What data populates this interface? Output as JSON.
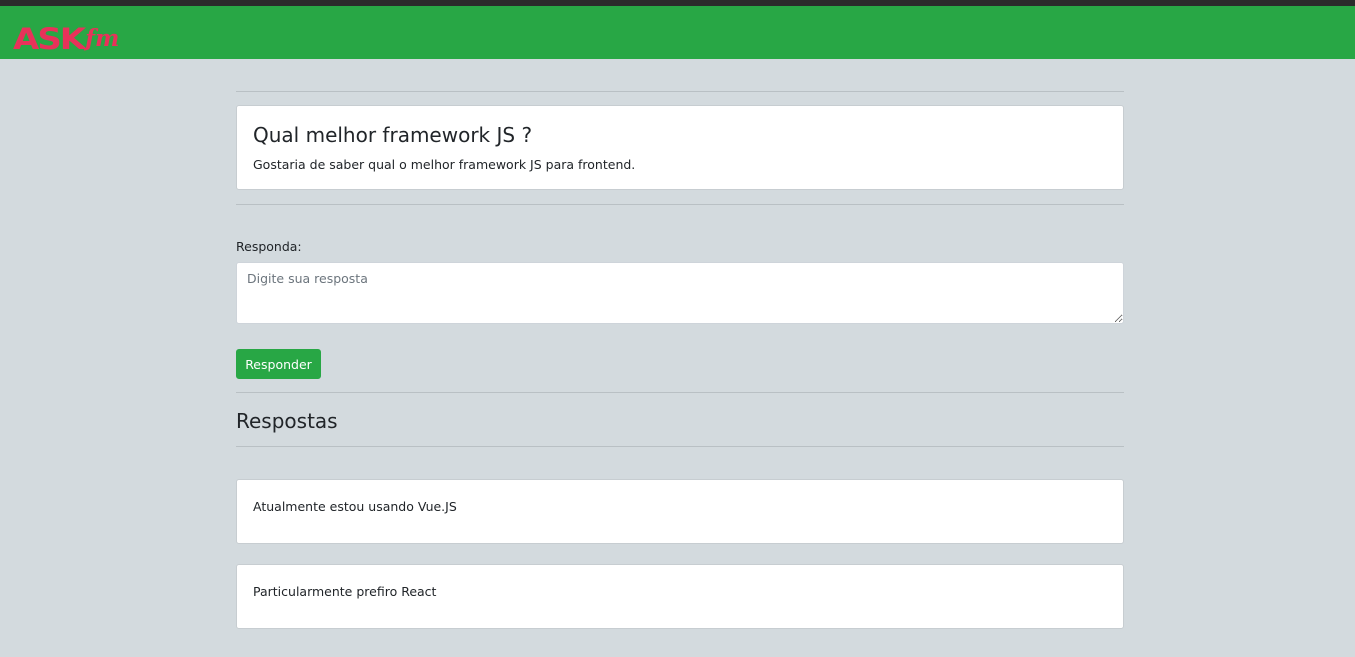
{
  "header": {
    "logo_main": "ASK",
    "logo_suffix": "fm"
  },
  "question": {
    "title": "Qual melhor framework JS ?",
    "description": "Gostaria de saber qual o melhor framework JS para frontend."
  },
  "reply_form": {
    "label": "Responda:",
    "placeholder": "Digite sua resposta",
    "value": "",
    "submit_label": "Responder"
  },
  "answers": {
    "heading": "Respostas",
    "items": [
      {
        "text": "Atualmente estou usando Vue.JS"
      },
      {
        "text": "Particularmente prefiro React"
      }
    ]
  },
  "colors": {
    "navbar": "#28a745",
    "logo": "#e8325a",
    "page_background": "#d3dade",
    "button": "#28a745"
  }
}
